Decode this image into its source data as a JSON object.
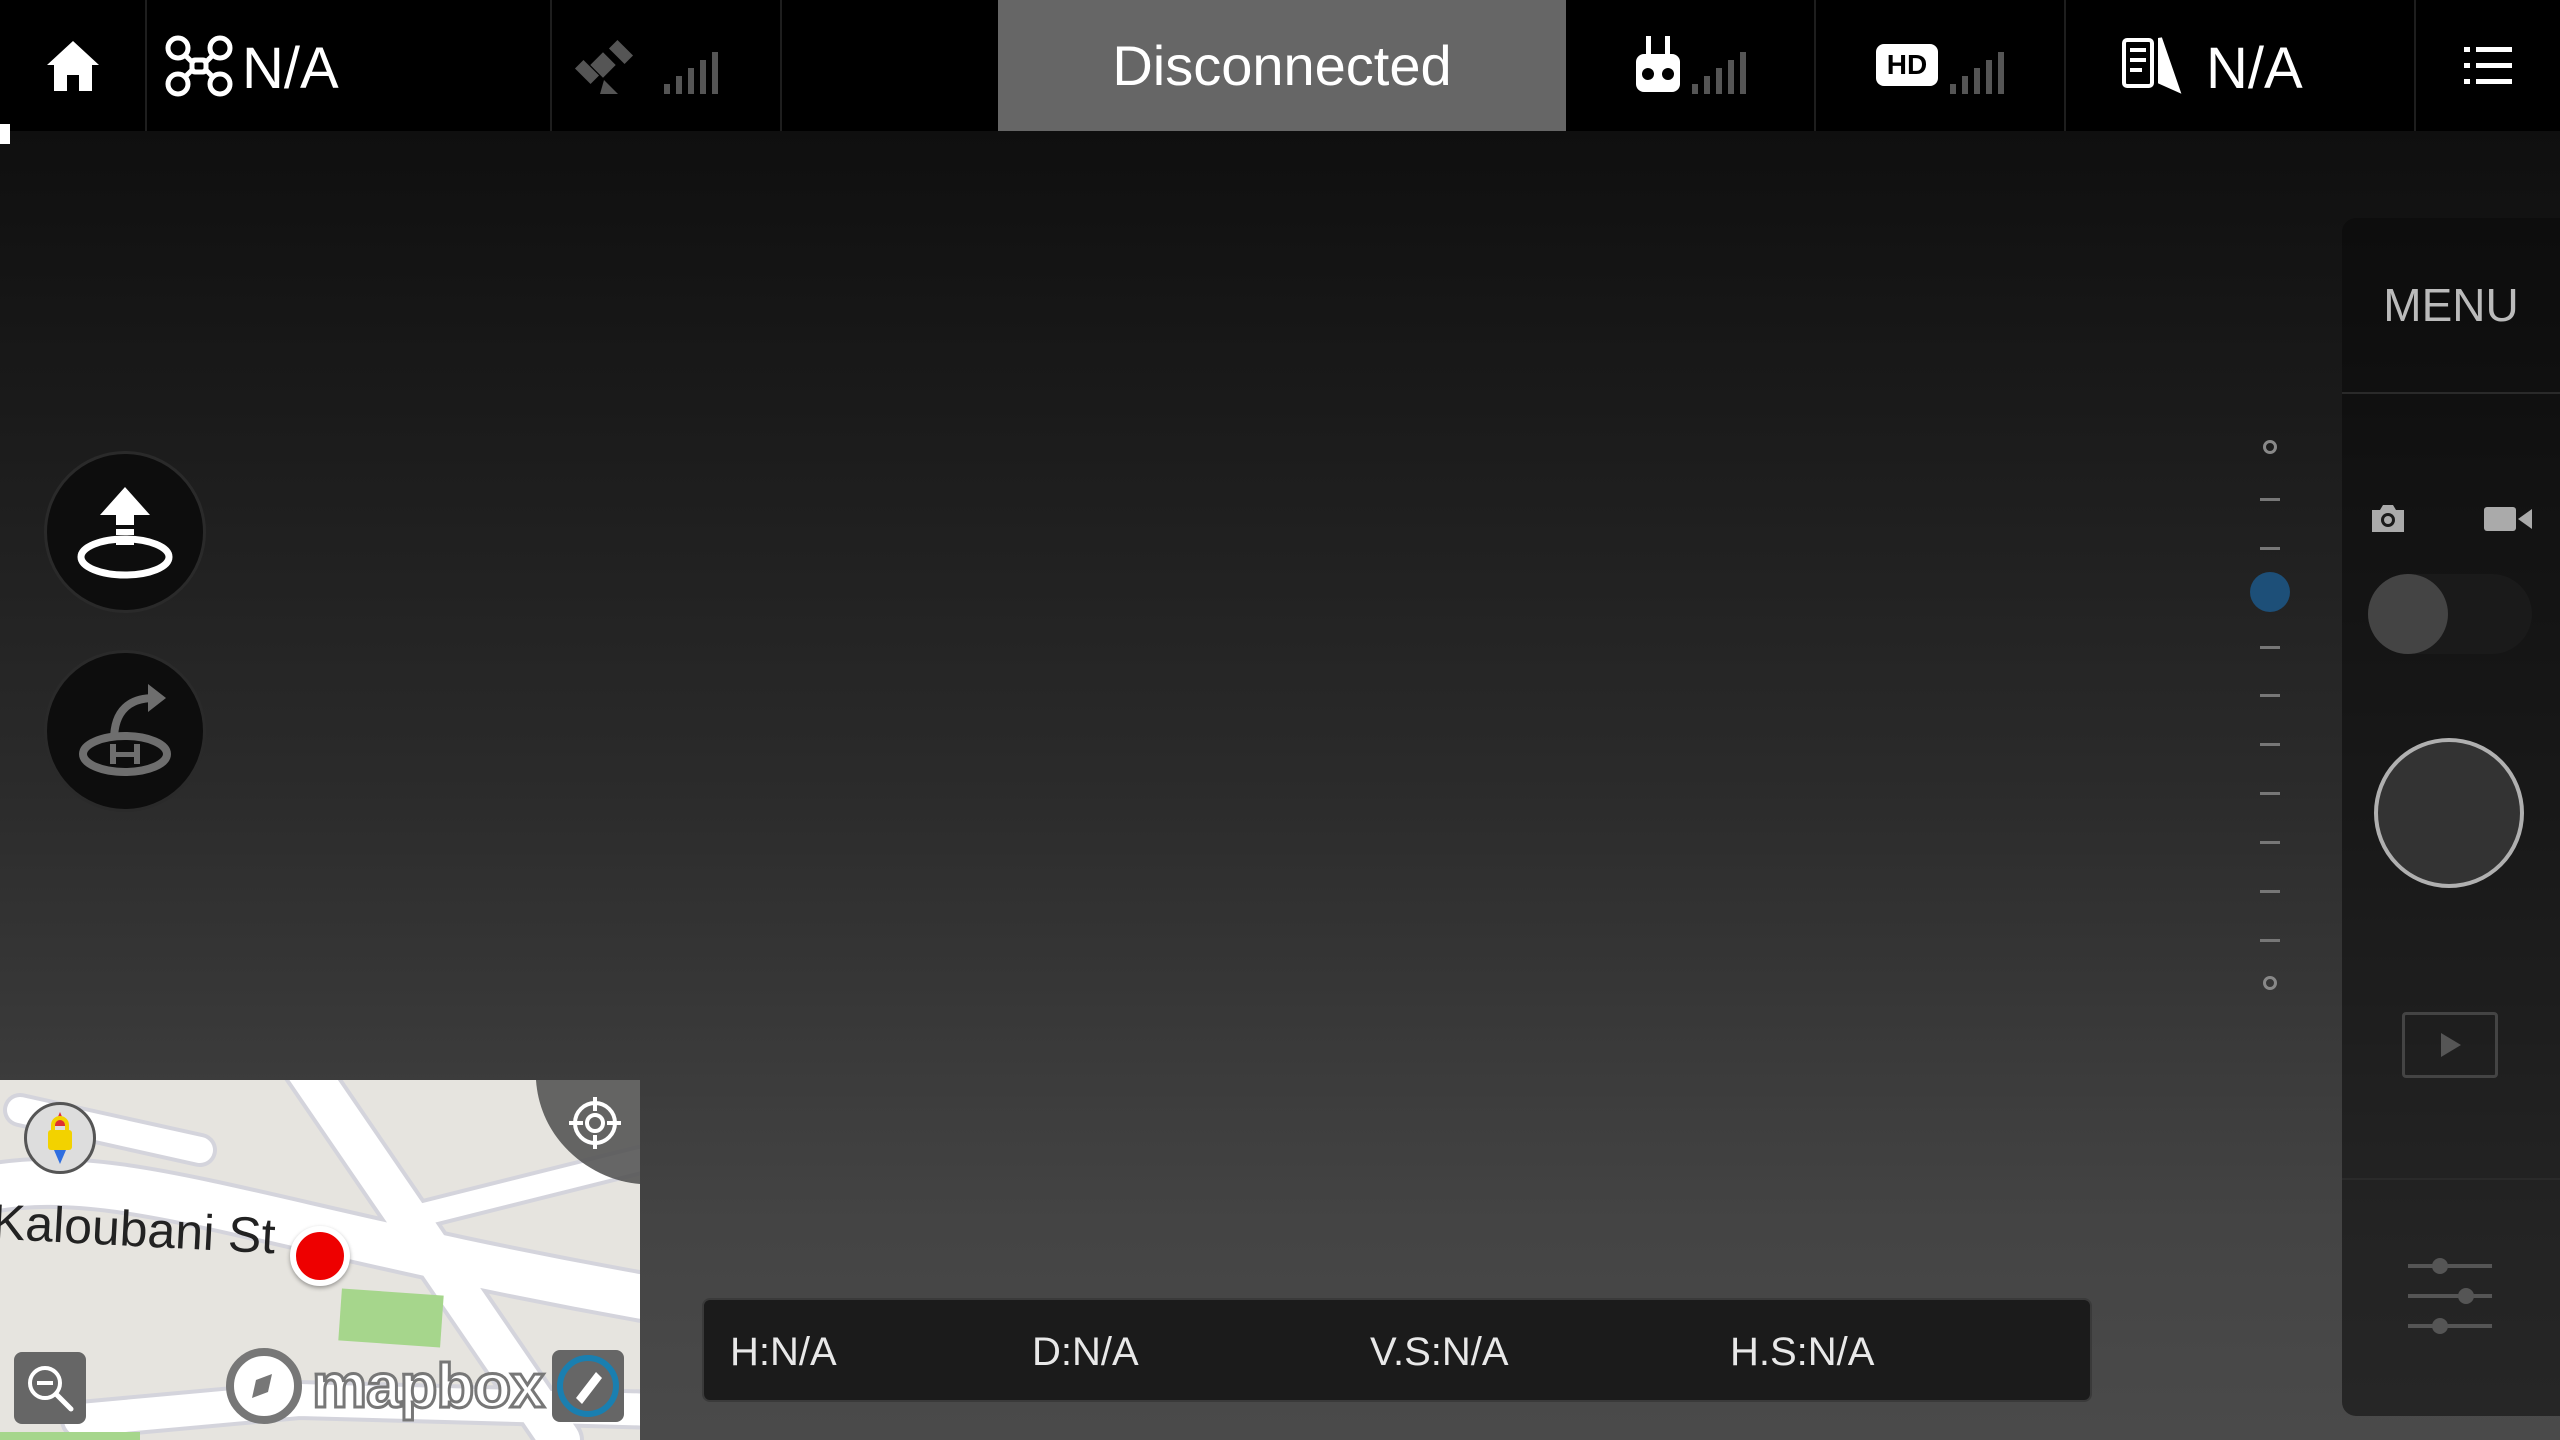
{
  "topbar": {
    "aircraft_value": "N/A",
    "connection_status": "Disconnected",
    "ap_value": "N/A",
    "hd_badge": "HD"
  },
  "right_panel": {
    "menu_label": "MENU"
  },
  "telemetry": {
    "height": "H:N/A",
    "distance": "D:N/A",
    "vertical_speed": "V.S:N/A",
    "horizontal_speed": "H.S:N/A"
  },
  "map": {
    "street_label": "Kaloubani St",
    "logo_text": "mapbox"
  },
  "colors": {
    "status_banner": "#666666",
    "accent_blue": "#1d4f78",
    "map_marker": "#ee0000"
  },
  "icons": [
    "home-icon",
    "drone-icon",
    "satellite-icon",
    "remote-controller-icon",
    "hd-video-icon",
    "checklist-icon",
    "list-menu-icon",
    "takeoff-icon",
    "return-home-icon",
    "camera-icon",
    "video-camera-icon",
    "play-icon",
    "sliders-icon",
    "compass-lock-icon",
    "locate-icon",
    "zoom-out-icon"
  ]
}
